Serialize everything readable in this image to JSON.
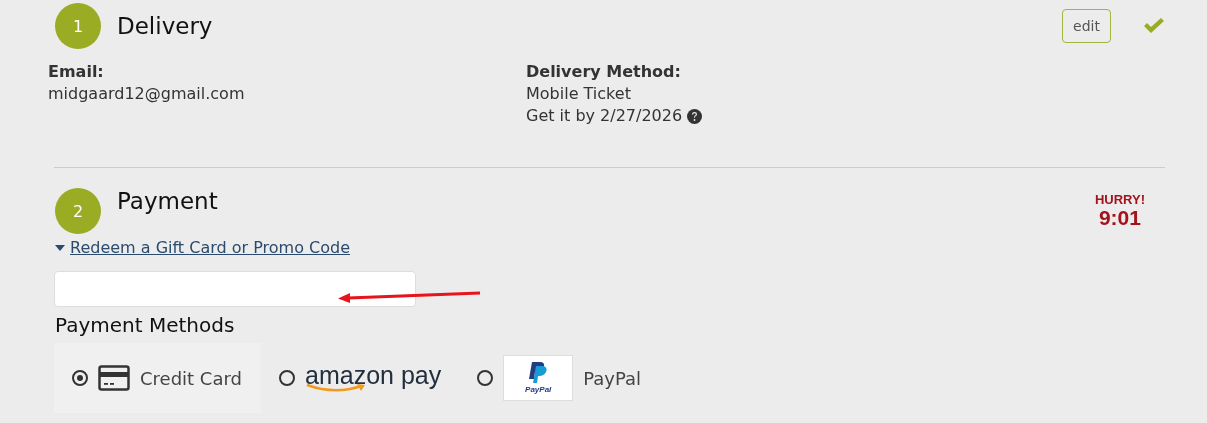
{
  "delivery": {
    "step": "1",
    "title": "Delivery",
    "edit_button": "edit",
    "complete": true,
    "email_label": "Email:",
    "email": "midgaard12@gmail.com",
    "method_label": "Delivery Method:",
    "method": "Mobile Ticket",
    "eta": "Get it by 2/27/2026"
  },
  "payment": {
    "step": "2",
    "title": "Payment",
    "timer_label": "HURRY!",
    "timer": "9:01",
    "promo_link": "Redeem a Gift Card or Promo Code",
    "promo_expanded": true,
    "methods_heading": "Payment Methods",
    "methods": [
      {
        "kind": "card",
        "label": "Credit Card",
        "selected": true
      },
      {
        "kind": "amazon",
        "label": "amazon pay",
        "selected": false
      },
      {
        "kind": "paypal",
        "logo_text": "PayPal",
        "label": "PayPal",
        "selected": false
      }
    ]
  }
}
